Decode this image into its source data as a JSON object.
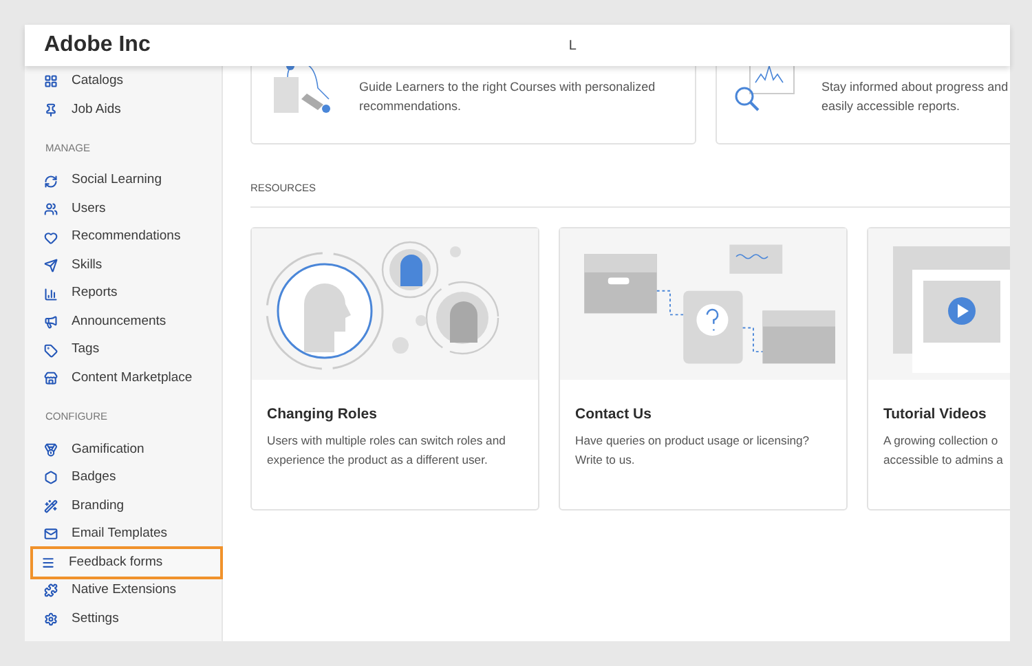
{
  "header": {
    "title": "Adobe Inc",
    "text": "L"
  },
  "sidebar": {
    "sections": [
      {
        "items": [
          {
            "label": "Catalogs",
            "highlighted": false
          },
          {
            "label": "Job Aids",
            "highlighted": false
          }
        ]
      },
      {
        "heading": "MANAGE",
        "items": [
          {
            "label": "Social Learning",
            "highlighted": false
          },
          {
            "label": "Users",
            "highlighted": false
          },
          {
            "label": "Recommendations",
            "highlighted": false
          },
          {
            "label": "Skills",
            "highlighted": false
          },
          {
            "label": "Reports",
            "highlighted": false
          },
          {
            "label": "Announcements",
            "highlighted": false
          },
          {
            "label": "Tags",
            "highlighted": false
          },
          {
            "label": "Content Marketplace",
            "highlighted": false
          }
        ]
      },
      {
        "heading": "CONFIGURE",
        "items": [
          {
            "label": "Gamification",
            "highlighted": false
          },
          {
            "label": "Badges",
            "highlighted": false
          },
          {
            "label": "Branding",
            "highlighted": false
          },
          {
            "label": "Email Templates",
            "highlighted": false
          },
          {
            "label": "Feedback forms",
            "highlighted": true
          },
          {
            "label": "Native Extensions",
            "highlighted": false
          },
          {
            "label": "Settings",
            "highlighted": false
          }
        ]
      }
    ]
  },
  "top_cards": [
    {
      "lines": [
        "Guide Learners to the right Courses with personalized",
        "recommendations."
      ]
    },
    {
      "lines": [
        "Stay informed about progress and",
        "easily accessible reports."
      ]
    }
  ],
  "resources": {
    "heading": "RESOURCES",
    "cards": [
      {
        "title": "Changing Roles",
        "lines": [
          "Users with multiple roles can switch roles and",
          "experience the product as a different user."
        ]
      },
      {
        "title": "Contact Us",
        "lines": [
          "Have queries on product usage or licensing?",
          "Write to us."
        ]
      },
      {
        "title": "Tutorial Videos",
        "lines": [
          "A growing collection o",
          "accessible to admins a"
        ]
      }
    ]
  }
}
